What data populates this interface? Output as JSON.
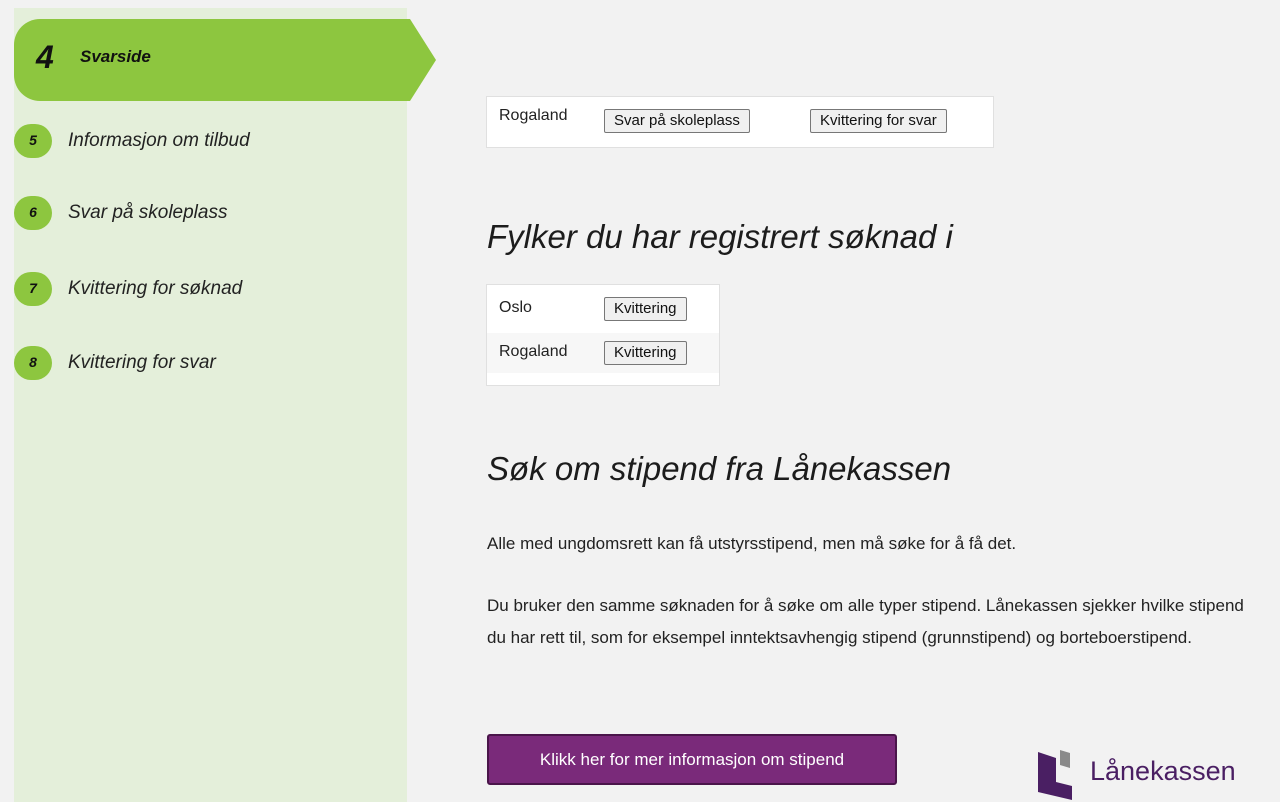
{
  "sidebar": {
    "current": {
      "number": "4",
      "label": "Svarside"
    },
    "steps": [
      {
        "number": "5",
        "label": "Informasjon om tilbud"
      },
      {
        "number": "6",
        "label": "Svar på skoleplass"
      },
      {
        "number": "7",
        "label": "Kvittering for søknad"
      },
      {
        "number": "8",
        "label": "Kvittering for svar"
      }
    ]
  },
  "answer_box": {
    "county": "Rogaland",
    "answer_button": "Svar på skoleplass",
    "receipt_button": "Kvittering for svar"
  },
  "registered": {
    "heading": "Fylker du har registrert søknad i",
    "rows": [
      {
        "county": "Oslo",
        "button": "Kvittering"
      },
      {
        "county": "Rogaland",
        "button": "Kvittering"
      }
    ]
  },
  "stipend": {
    "heading": "Søk om stipend fra Lånekassen",
    "paragraph1": "Alle med ungdomsrett kan få utstyrsstipend, men må søke for å få det.",
    "paragraph2": "Du bruker den samme søknaden for å søke om alle typer stipend. Lånekassen sjekker hvilke stipend du har rett til, som for eksempel inntektsavhengig stipend (grunnstipend) og borteboerstipend.",
    "cta": "Klikk her for mer informasjon om stipend"
  },
  "logo": {
    "text": "Lånekassen",
    "color": "#4a1f63",
    "icon": "lanekassen-logo-icon"
  },
  "colors": {
    "step_green": "#8dc63f",
    "sidebar_bg": "#e4efda",
    "cta_purple": "#7a2a7a"
  }
}
